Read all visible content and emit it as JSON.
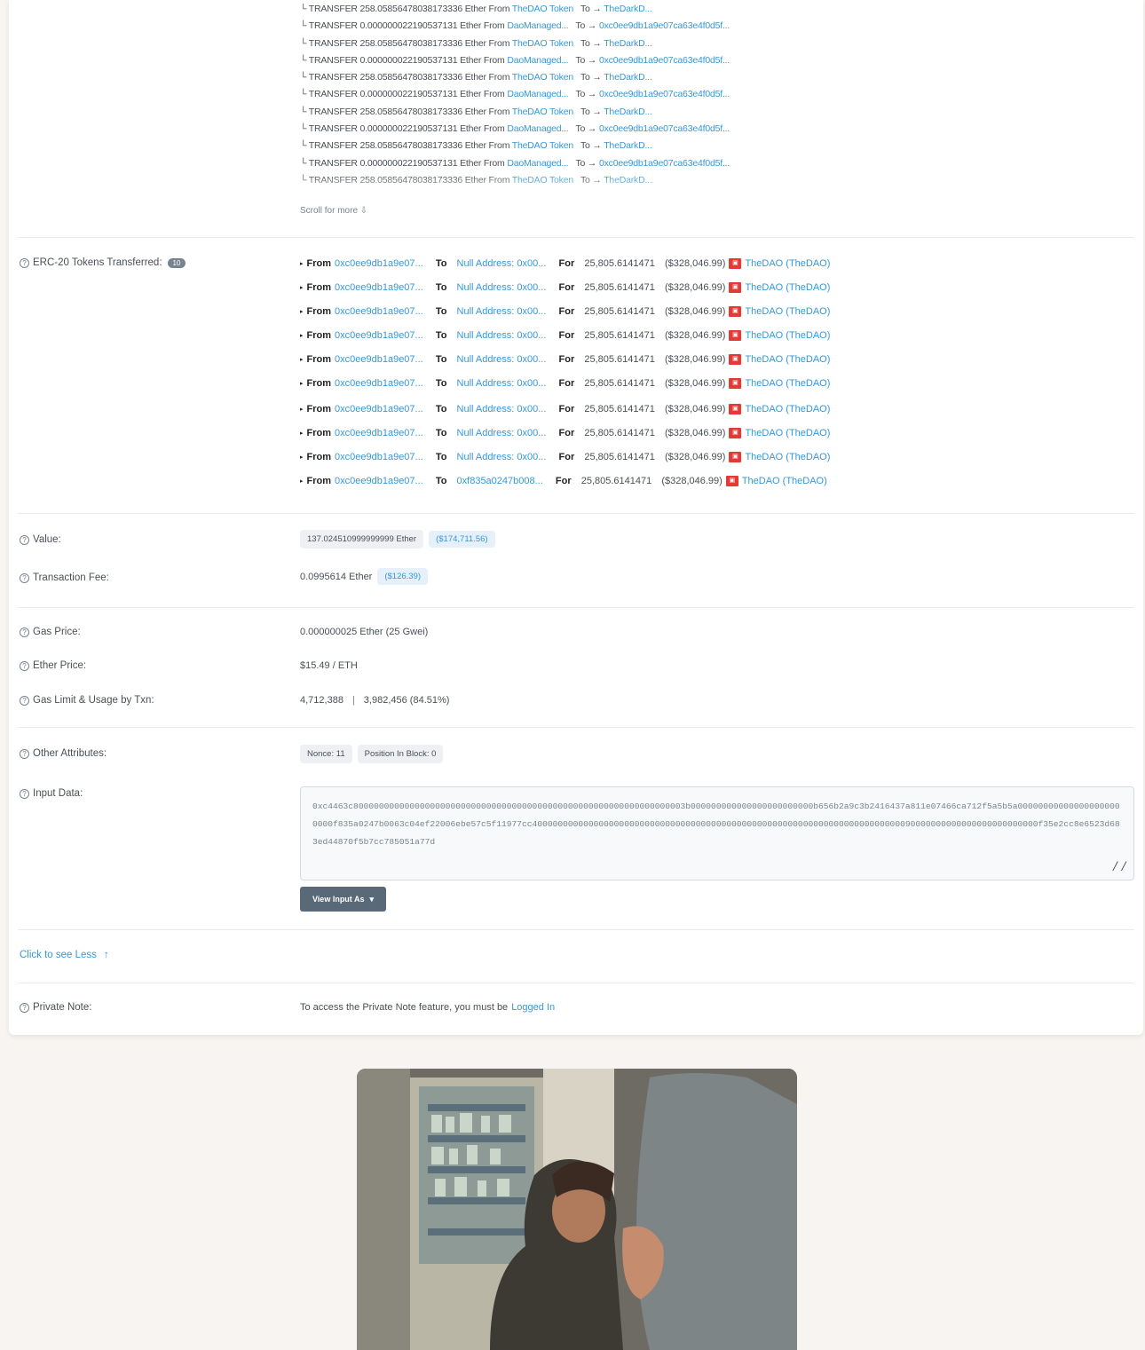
{
  "internal_txns": [
    {
      "kind": "TRANSFER",
      "amount": "258.05856478038173336 Ether",
      "from_label": "From",
      "from": "TheDAO Token",
      "to_label": "To",
      "to": "TheDarkD..."
    },
    {
      "kind": "TRANSFER",
      "amount": "0.000000022190537131 Ether",
      "from_label": "From",
      "from": "DaoManaged...",
      "to_label": "To",
      "to": "0xc0ee9db1a9e07ca63e4f0d5f..."
    },
    {
      "kind": "TRANSFER",
      "amount": "258.05856478038173336 Ether",
      "from_label": "From",
      "from": "TheDAO Token",
      "to_label": "To",
      "to": "TheDarkD..."
    },
    {
      "kind": "TRANSFER",
      "amount": "0.000000022190537131 Ether",
      "from_label": "From",
      "from": "DaoManaged...",
      "to_label": "To",
      "to": "0xc0ee9db1a9e07ca63e4f0d5f..."
    },
    {
      "kind": "TRANSFER",
      "amount": "258.05856478038173336 Ether",
      "from_label": "From",
      "from": "TheDAO Token",
      "to_label": "To",
      "to": "TheDarkD..."
    },
    {
      "kind": "TRANSFER",
      "amount": "0.000000022190537131 Ether",
      "from_label": "From",
      "from": "DaoManaged...",
      "to_label": "To",
      "to": "0xc0ee9db1a9e07ca63e4f0d5f..."
    },
    {
      "kind": "TRANSFER",
      "amount": "258.05856478038173336 Ether",
      "from_label": "From",
      "from": "TheDAO Token",
      "to_label": "To",
      "to": "TheDarkD..."
    },
    {
      "kind": "TRANSFER",
      "amount": "0.000000022190537131 Ether",
      "from_label": "From",
      "from": "DaoManaged...",
      "to_label": "To",
      "to": "0xc0ee9db1a9e07ca63e4f0d5f..."
    },
    {
      "kind": "TRANSFER",
      "amount": "258.05856478038173336 Ether",
      "from_label": "From",
      "from": "TheDAO Token",
      "to_label": "To",
      "to": "TheDarkD..."
    },
    {
      "kind": "TRANSFER",
      "amount": "0.000000022190537131 Ether",
      "from_label": "From",
      "from": "DaoManaged...",
      "to_label": "To",
      "to": "0xc0ee9db1a9e07ca63e4f0d5f..."
    },
    {
      "kind": "TRANSFER",
      "amount": "258.05856478038173336 Ether",
      "from_label": "From",
      "from": "TheDAO Token",
      "to_label": "To",
      "to": "TheDarkD..."
    }
  ],
  "scroll_more": "Scroll for more",
  "erc20": {
    "label": "ERC-20 Tokens Transferred:",
    "count": "10",
    "rows": [
      {
        "from_label": "From",
        "from": "0xc0ee9db1a9e07...",
        "to_label": "To",
        "to": "Null Address: 0x00...",
        "for_label": "For",
        "amount": "25,805.6141471",
        "usd": "($328,046.99)",
        "token": "TheDAO (TheDAO)"
      },
      {
        "from_label": "From",
        "from": "0xc0ee9db1a9e07...",
        "to_label": "To",
        "to": "Null Address: 0x00...",
        "for_label": "For",
        "amount": "25,805.6141471",
        "usd": "($328,046.99)",
        "token": "TheDAO (TheDAO)"
      },
      {
        "from_label": "From",
        "from": "0xc0ee9db1a9e07...",
        "to_label": "To",
        "to": "Null Address: 0x00...",
        "for_label": "For",
        "amount": "25,805.6141471",
        "usd": "($328,046.99)",
        "token": "TheDAO (TheDAO)"
      },
      {
        "from_label": "From",
        "from": "0xc0ee9db1a9e07...",
        "to_label": "To",
        "to": "Null Address: 0x00...",
        "for_label": "For",
        "amount": "25,805.6141471",
        "usd": "($328,046.99)",
        "token": "TheDAO (TheDAO)"
      },
      {
        "from_label": "From",
        "from": "0xc0ee9db1a9e07...",
        "to_label": "To",
        "to": "Null Address: 0x00...",
        "for_label": "For",
        "amount": "25,805.6141471",
        "usd": "($328,046.99)",
        "token": "TheDAO (TheDAO)"
      },
      {
        "from_label": "From",
        "from": "0xc0ee9db1a9e07...",
        "to_label": "To",
        "to": "Null Address: 0x00...",
        "for_label": "For",
        "amount": "25,805.6141471",
        "usd": "($328,046.99)",
        "token": "TheDAO (TheDAO)"
      },
      {
        "from_label": "From",
        "from": "0xc0ee9db1a9e07...",
        "to_label": "To",
        "to": "Null Address: 0x00...",
        "for_label": "For",
        "amount": "25,805.6141471",
        "usd": "($328,046.99)",
        "token": "TheDAO (TheDAO)"
      },
      {
        "from_label": "From",
        "from": "0xc0ee9db1a9e07...",
        "to_label": "To",
        "to": "Null Address: 0x00...",
        "for_label": "For",
        "amount": "25,805.6141471",
        "usd": "($328,046.99)",
        "token": "TheDAO (TheDAO)"
      },
      {
        "from_label": "From",
        "from": "0xc0ee9db1a9e07...",
        "to_label": "To",
        "to": "Null Address: 0x00...",
        "for_label": "For",
        "amount": "25,805.6141471",
        "usd": "($328,046.99)",
        "token": "TheDAO (TheDAO)"
      },
      {
        "from_label": "From",
        "from": "0xc0ee9db1a9e07...",
        "to_label": "To",
        "to": "0xf835a0247b008...",
        "for_label": "For",
        "amount": "25,805.6141471",
        "usd": "($328,046.99)",
        "token": "TheDAO (TheDAO)"
      }
    ]
  },
  "value": {
    "label": "Value:",
    "ether": "137.024510999999999 Ether",
    "usd": "($174,711.56)"
  },
  "fee": {
    "label": "Transaction Fee:",
    "ether": "0.0995614 Ether",
    "usd": "($126.39)"
  },
  "gas_price": {
    "label": "Gas Price:",
    "value": "0.000000025 Ether (25 Gwei)"
  },
  "ether_price": {
    "label": "Ether Price:",
    "value": "$15.49 / ETH"
  },
  "gas_limit": {
    "label": "Gas Limit & Usage by Txn:",
    "limit": "4,712,388",
    "sep": "|",
    "usage": "3,982,456 (84.51%)"
  },
  "other": {
    "label": "Other Attributes:",
    "nonce": "Nonce: 11",
    "position": "Position In Block: 0"
  },
  "input": {
    "label": "Input Data:",
    "data": "0xc4463c80000000000000000000000000000000000000000000000000000000000000003b000000000000000000000000b656b2a9c3b2416437a811e07466ca712f5a5b5a000000000000000000000000f835a0247b0063c04ef22006ebe57c5f11977cc400000000000000000000000000000000000000000000000000000000000000000000000090000000000000000000000000f35e2cc8e6523d683ed44870f5b7cc785051a77d",
    "view_button": "View Input As"
  },
  "see_less": "Click to see Less",
  "private_note": {
    "label": "Private Note:",
    "text": "To access the Private Note feature, you must be",
    "link": "Logged In"
  },
  "colors": {
    "link": "#3498db",
    "dao_red": "#e53935"
  }
}
